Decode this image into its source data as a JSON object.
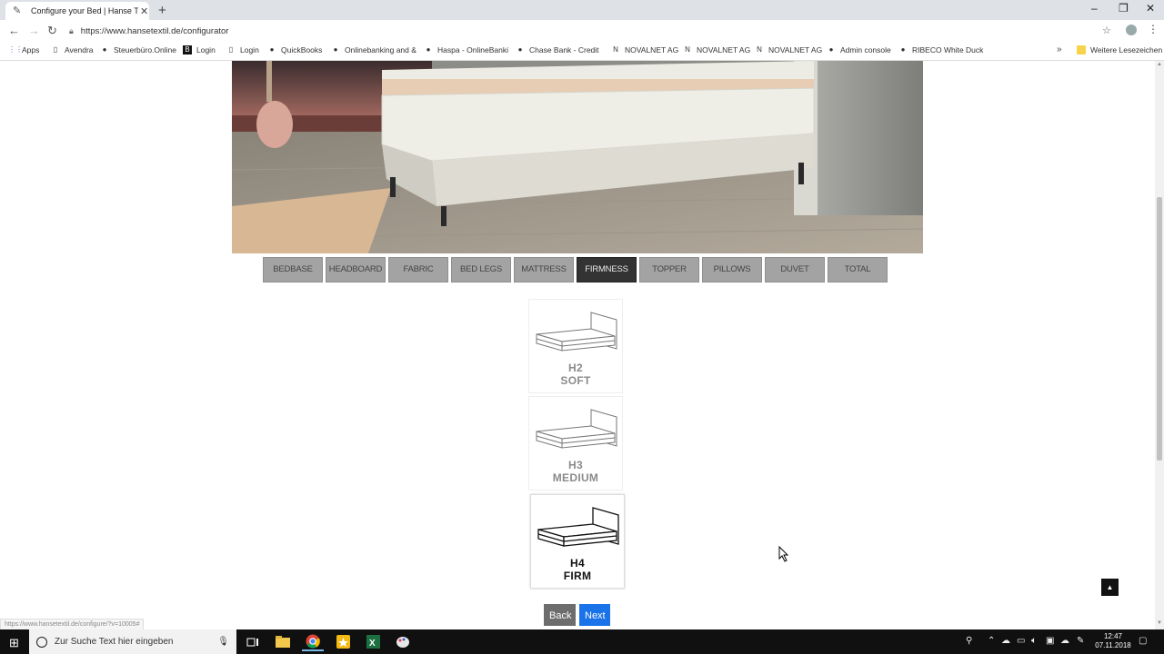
{
  "browser": {
    "tab_title": "Configure your Bed | Hanse Textil",
    "url": "https://www.hansetextil.de/configurator",
    "bookmarks": [
      {
        "label": "Apps",
        "icon": "apps-grid-icon"
      },
      {
        "label": "Avendra",
        "icon": "page-icon"
      },
      {
        "label": "Steuerbüro.Online",
        "icon": "steuerburo-icon"
      },
      {
        "label": "Login",
        "icon": "b-logo-icon"
      },
      {
        "label": "Login",
        "icon": "page-icon"
      },
      {
        "label": "QuickBooks",
        "icon": "quickbooks-icon"
      },
      {
        "label": "Onlinebanking and &",
        "icon": "bank-icon"
      },
      {
        "label": "Haspa - OnlineBanki",
        "icon": "haspa-icon"
      },
      {
        "label": "Chase Bank - Credit",
        "icon": "chase-icon"
      },
      {
        "label": "NOVALNET AG",
        "icon": "novalnet-icon"
      },
      {
        "label": "NOVALNET AG",
        "icon": "novalnet-icon"
      },
      {
        "label": "NOVALNET AG",
        "icon": "novalnet-icon"
      },
      {
        "label": "Admin console",
        "icon": "admin-icon"
      },
      {
        "label": "RIBECO White Duck",
        "icon": "ribeco-icon"
      }
    ],
    "other_bookmarks": "Weitere Lesezeichen"
  },
  "configurator": {
    "steps": [
      {
        "label": "BEDBASE",
        "active": false
      },
      {
        "label": "HEADBOARD",
        "active": false
      },
      {
        "label": "FABRIC",
        "active": false
      },
      {
        "label": "BED LEGS",
        "active": false
      },
      {
        "label": "MATTRESS",
        "active": false
      },
      {
        "label": "FIRMNESS",
        "active": true
      },
      {
        "label": "TOPPER",
        "active": false
      },
      {
        "label": "PILLOWS",
        "active": false
      },
      {
        "label": "DUVET",
        "active": false
      },
      {
        "label": "TOTAL",
        "active": false
      }
    ],
    "options": [
      {
        "level": "H2",
        "label": "SOFT",
        "selected": false
      },
      {
        "level": "H3",
        "label": "MEDIUM",
        "selected": false
      },
      {
        "level": "H4",
        "label": "FIRM",
        "selected": true
      }
    ],
    "back_label": "Back",
    "next_label": "Next"
  },
  "status_url": "https://www.hansetextil.de/configure/?v=10005#",
  "taskbar": {
    "search_placeholder": "Zur Suche Text hier eingeben",
    "time": "12:47",
    "date": "07.11.2018"
  },
  "colors": {
    "active_step": "#333333",
    "step": "#a3a3a3",
    "next_button": "#1a73e8",
    "back_button": "#6d6d6d"
  }
}
